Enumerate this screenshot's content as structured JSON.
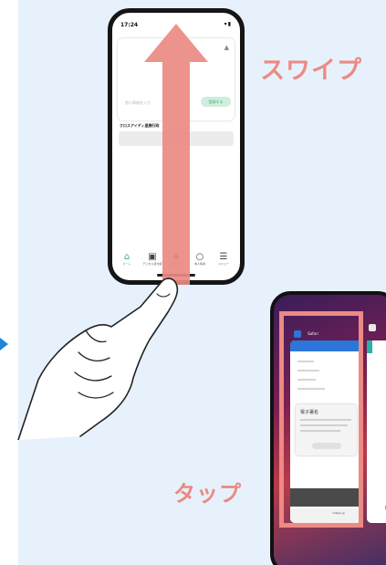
{
  "labels": {
    "swipe": "スワイプ",
    "tap": "タップ"
  },
  "phone1": {
    "status_time": "17:24",
    "card_placeholder": "個人情報を入力",
    "card_button": "登録する",
    "section_title": "クロスアイディ連携行政",
    "tabs": [
      {
        "label": "ホーム",
        "icon": "home-icon"
      },
      {
        "label": "デジタル身分証",
        "icon": "id-card-icon"
      },
      {
        "label": "お知らせ",
        "icon": "bell-icon"
      },
      {
        "label": "本人情報",
        "icon": "person-icon"
      },
      {
        "label": "メニュー",
        "icon": "menu-icon"
      }
    ]
  },
  "phone2": {
    "app_name": "Safari",
    "dialog_title": "電子署名",
    "url_text": "xidapp.jp"
  },
  "colors": {
    "background_panel": "#e6f1fb",
    "accent_pink": "#ec8a83",
    "accent_green": "#3bae72",
    "side_arrow": "#1e88d6"
  }
}
